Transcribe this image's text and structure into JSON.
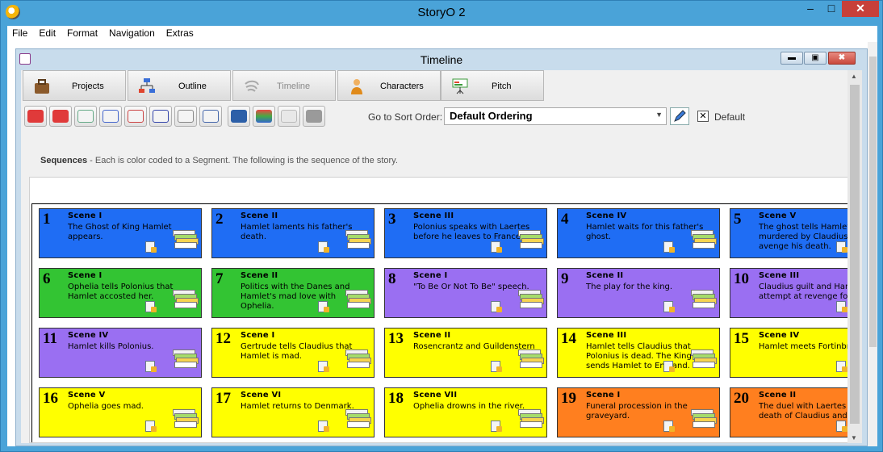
{
  "app": {
    "title": "StoryO 2",
    "menu": [
      "File",
      "Edit",
      "Format",
      "Navigation",
      "Extras"
    ],
    "window_buttons": {
      "minimize": "–",
      "maximize": "□",
      "close": "✕"
    }
  },
  "child": {
    "title": "Timeline",
    "buttons": {
      "minimize": "▬",
      "maximize": "▣",
      "close": "✖"
    }
  },
  "tabs": [
    {
      "label": "Projects"
    },
    {
      "label": "Outline"
    },
    {
      "label": "Timeline"
    },
    {
      "label": "Characters"
    },
    {
      "label": "Pitch"
    }
  ],
  "toolbar": {
    "sort_label": "Go to Sort Order:",
    "sort_value": "Default Ordering",
    "default_checked": "✕",
    "default_label": "Default"
  },
  "caption": {
    "bold": "Sequences",
    "text": " - Each is color coded to a Segment. The following is the sequence of the story."
  },
  "colors": {
    "blue": "#1f6df4",
    "green": "#33c433",
    "purple": "#9a6ff2",
    "yellow": "#ffff00",
    "orange": "#ff7f1f"
  },
  "cards": [
    {
      "num": "1",
      "scene": "Scene I",
      "desc": "The Ghost of King Hamlet appears.",
      "color": "blue"
    },
    {
      "num": "2",
      "scene": "Scene II",
      "desc": "Hamlet laments his father's death.",
      "color": "blue"
    },
    {
      "num": "3",
      "scene": "Scene III",
      "desc": "Polonius speaks with Laertes before he leaves to France.",
      "color": "blue"
    },
    {
      "num": "4",
      "scene": "Scene IV",
      "desc": "Hamlet waits for this father's ghost.",
      "color": "blue"
    },
    {
      "num": "5",
      "scene": "Scene V",
      "desc": "The ghost tells Hamlet he was murdered by Claudius. Hamlet avenge his death.",
      "color": "blue"
    },
    {
      "num": "6",
      "scene": "Scene I",
      "desc": "Ophelia tells Polonius that Hamlet accosted her.",
      "color": "green"
    },
    {
      "num": "7",
      "scene": "Scene II",
      "desc": "Politics with the Danes and Hamlet's mad love with Ophelia.",
      "color": "green"
    },
    {
      "num": "8",
      "scene": "Scene I",
      "desc": "\"To Be Or Not To Be\" speech.",
      "color": "purple"
    },
    {
      "num": "9",
      "scene": "Scene II",
      "desc": "The play for the king.",
      "color": "purple"
    },
    {
      "num": "10",
      "scene": "Scene III",
      "desc": "Claudius guilt and Hamlet's first attempt at revenge foiled.",
      "color": "purple"
    },
    {
      "num": "11",
      "scene": "Scene IV",
      "desc": "Hamlet kills Polonius.",
      "color": "purple"
    },
    {
      "num": "12",
      "scene": "Scene I",
      "desc": "Gertrude tells Claudius that Hamlet is mad.",
      "color": "yellow"
    },
    {
      "num": "13",
      "scene": "Scene II",
      "desc": "Rosencrantz and Guildenstern",
      "color": "yellow"
    },
    {
      "num": "14",
      "scene": "Scene III",
      "desc": "Hamlet tells Claudius that Polonius is dead. The King sends Hamlet to England.",
      "color": "yellow"
    },
    {
      "num": "15",
      "scene": "Scene IV",
      "desc": "Hamlet meets Fortinbras",
      "color": "yellow"
    },
    {
      "num": "16",
      "scene": "Scene V",
      "desc": "Ophelia goes mad.",
      "color": "yellow"
    },
    {
      "num": "17",
      "scene": "Scene VI",
      "desc": "Hamlet returns to Denmark.",
      "color": "yellow"
    },
    {
      "num": "18",
      "scene": "Scene VII",
      "desc": "Ophelia drowns in the river.",
      "color": "yellow"
    },
    {
      "num": "19",
      "scene": "Scene I",
      "desc": "Funeral procession in the graveyard.",
      "color": "orange"
    },
    {
      "num": "20",
      "scene": "Scene II",
      "desc": "The duel with Laertes and death of Claudius and Gertrude.",
      "color": "orange"
    }
  ]
}
